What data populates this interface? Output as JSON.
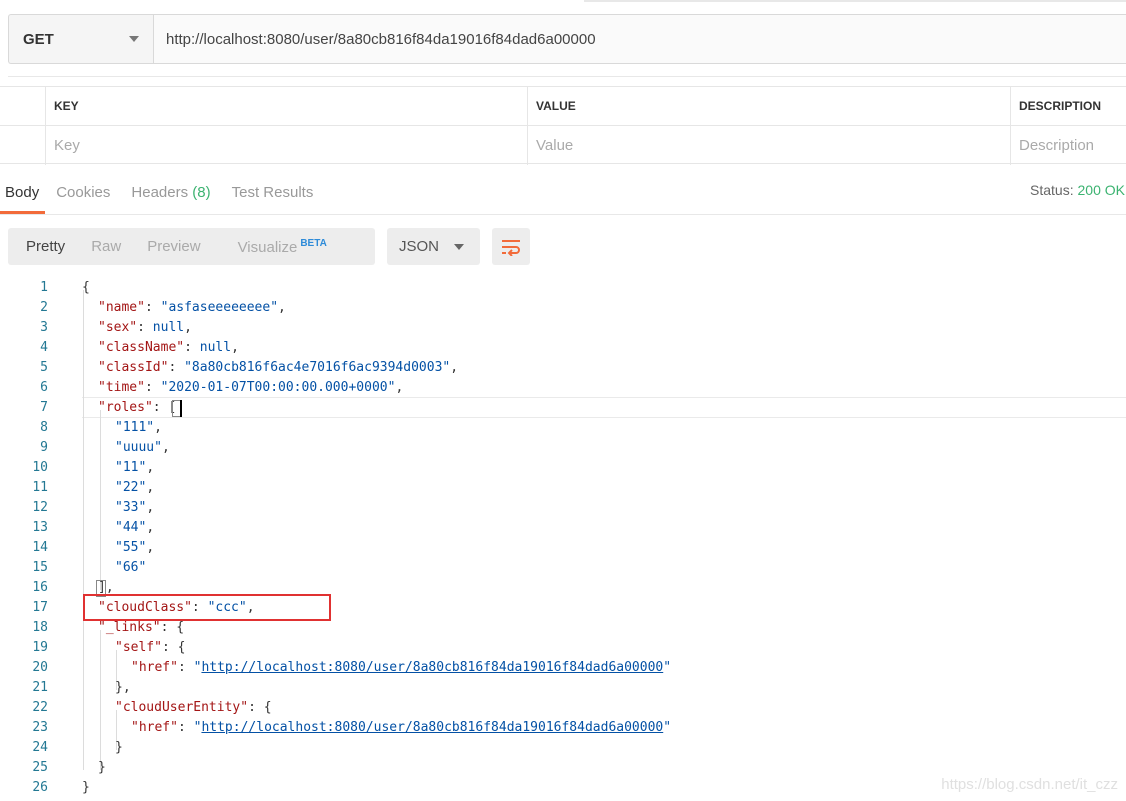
{
  "request": {
    "method": "GET",
    "url": "http://localhost:8080/user/8a80cb816f84da19016f84dad6a00000"
  },
  "params": {
    "headers": [
      "KEY",
      "VALUE",
      "DESCRIPTION"
    ],
    "placeholders": [
      "Key",
      "Value",
      "Description"
    ]
  },
  "response_tabs": {
    "body": "Body",
    "cookies": "Cookies",
    "headers": "Headers",
    "headers_count": "(8)",
    "test_results": "Test Results"
  },
  "status": {
    "label": "Status:",
    "value": "200 OK"
  },
  "view_modes": {
    "pretty": "Pretty",
    "raw": "Raw",
    "preview": "Preview",
    "visualize": "Visualize",
    "beta": "BETA"
  },
  "format": "JSON",
  "code": {
    "line_numbers": [
      "1",
      "2",
      "3",
      "4",
      "5",
      "6",
      "7",
      "8",
      "9",
      "10",
      "11",
      "12",
      "13",
      "14",
      "15",
      "16",
      "17",
      "18",
      "19",
      "20",
      "21",
      "22",
      "23",
      "24",
      "25",
      "26"
    ],
    "l2_key": "\"name\"",
    "l2_val": "\"asfaseeeeeeee\"",
    "l3_key": "\"sex\"",
    "l3_val": "null",
    "l4_key": "\"className\"",
    "l4_val": "null",
    "l5_key": "\"classId\"",
    "l5_val": "\"8a80cb816f6ac4e7016f6ac9394d0003\"",
    "l6_key": "\"time\"",
    "l6_val": "\"2020-01-07T00:00:00.000+0000\"",
    "l7_key": "\"roles\"",
    "roles": [
      "\"111\"",
      "\"uuuu\"",
      "\"11\"",
      "\"22\"",
      "\"33\"",
      "\"44\"",
      "\"55\"",
      "\"66\""
    ],
    "l17_key": "\"cloudClass\"",
    "l17_val": "\"ccc\"",
    "l18_key": "\"_links\"",
    "l19_key": "\"self\"",
    "l20_key": "\"href\"",
    "l20_val": "http://localhost:8080/user/8a80cb816f84da19016f84dad6a00000",
    "l22_key": "\"cloudUserEntity\"",
    "l23_key": "\"href\"",
    "l23_val": "http://localhost:8080/user/8a80cb816f84da19016f84dad6a00000"
  },
  "watermark": "https://blog.csdn.net/it_czz",
  "colors": {
    "accent": "#f26b3a",
    "status_ok": "#3cb371",
    "json_key": "#a31515",
    "json_value": "#0451a5",
    "highlight_box": "#e03131"
  }
}
